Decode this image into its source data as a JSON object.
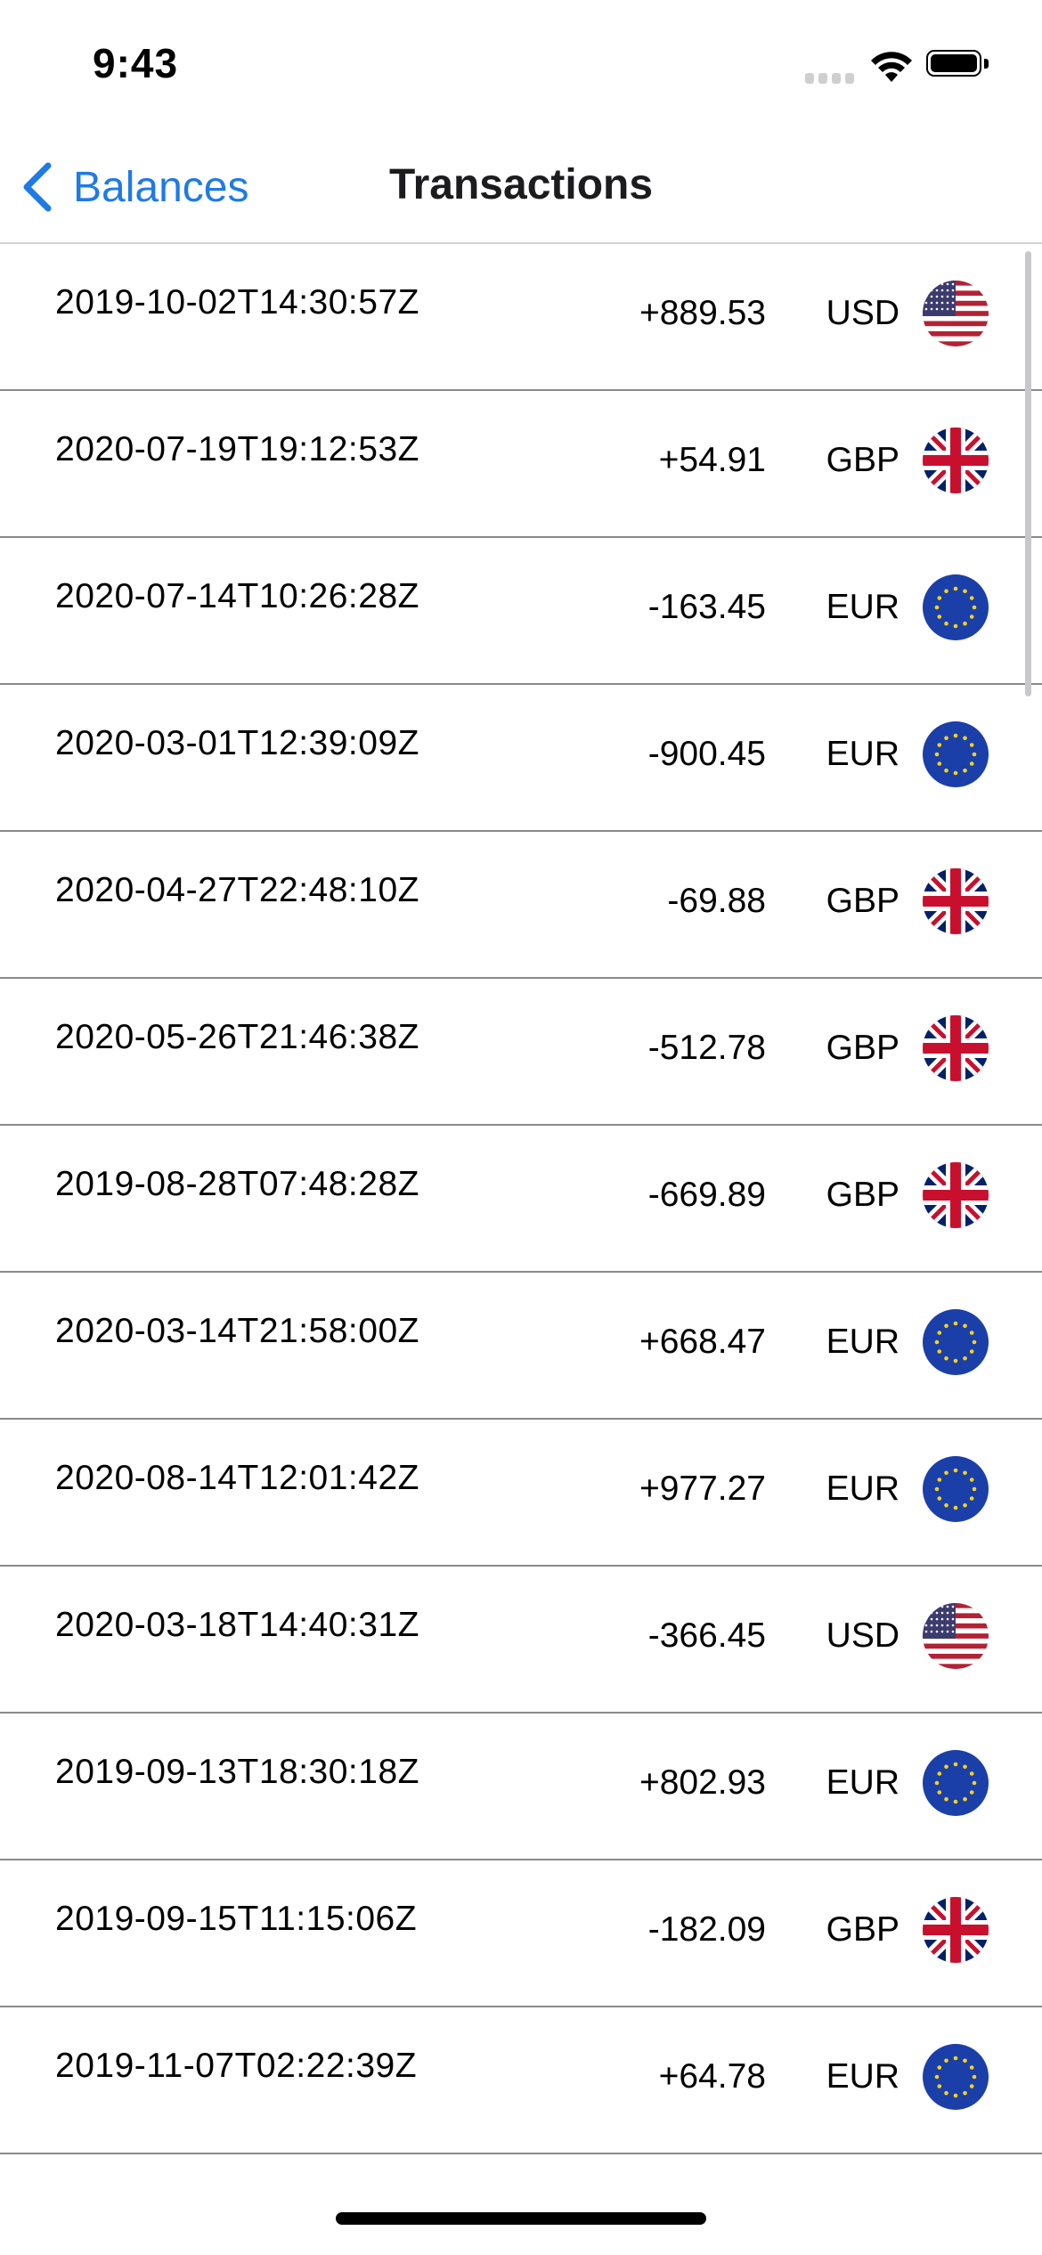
{
  "status_bar": {
    "time": "9:43"
  },
  "nav": {
    "back_label": "Balances",
    "title": "Transactions"
  },
  "transactions": [
    {
      "date": "2019-10-02T14:30:57Z",
      "amount": "+889.53",
      "currency": "USD",
      "flag": "us-flag-icon"
    },
    {
      "date": "2020-07-19T19:12:53Z",
      "amount": "+54.91",
      "currency": "GBP",
      "flag": "uk-flag-icon"
    },
    {
      "date": "2020-07-14T10:26:28Z",
      "amount": "-163.45",
      "currency": "EUR",
      "flag": "eu-flag-icon"
    },
    {
      "date": "2020-03-01T12:39:09Z",
      "amount": "-900.45",
      "currency": "EUR",
      "flag": "eu-flag-icon"
    },
    {
      "date": "2020-04-27T22:48:10Z",
      "amount": "-69.88",
      "currency": "GBP",
      "flag": "uk-flag-icon"
    },
    {
      "date": "2020-05-26T21:46:38Z",
      "amount": "-512.78",
      "currency": "GBP",
      "flag": "uk-flag-icon"
    },
    {
      "date": "2019-08-28T07:48:28Z",
      "amount": "-669.89",
      "currency": "GBP",
      "flag": "uk-flag-icon"
    },
    {
      "date": "2020-03-14T21:58:00Z",
      "amount": "+668.47",
      "currency": "EUR",
      "flag": "eu-flag-icon"
    },
    {
      "date": "2020-08-14T12:01:42Z",
      "amount": "+977.27",
      "currency": "EUR",
      "flag": "eu-flag-icon"
    },
    {
      "date": "2020-03-18T14:40:31Z",
      "amount": "-366.45",
      "currency": "USD",
      "flag": "us-flag-icon"
    },
    {
      "date": "2019-09-13T18:30:18Z",
      "amount": "+802.93",
      "currency": "EUR",
      "flag": "eu-flag-icon"
    },
    {
      "date": "2019-09-15T11:15:06Z",
      "amount": "-182.09",
      "currency": "GBP",
      "flag": "uk-flag-icon"
    },
    {
      "date": "2019-11-07T02:22:39Z",
      "amount": "+64.78",
      "currency": "EUR",
      "flag": "eu-flag-icon"
    }
  ],
  "colors": {
    "accent": "#1f7ae6",
    "separator": "#8a8a8e",
    "eu_blue": "#1b3fa8",
    "eu_star": "#f7d21e",
    "uk_red": "#c8102e",
    "uk_blue": "#012169",
    "us_red": "#b22234",
    "us_blue": "#3c3b6e"
  }
}
